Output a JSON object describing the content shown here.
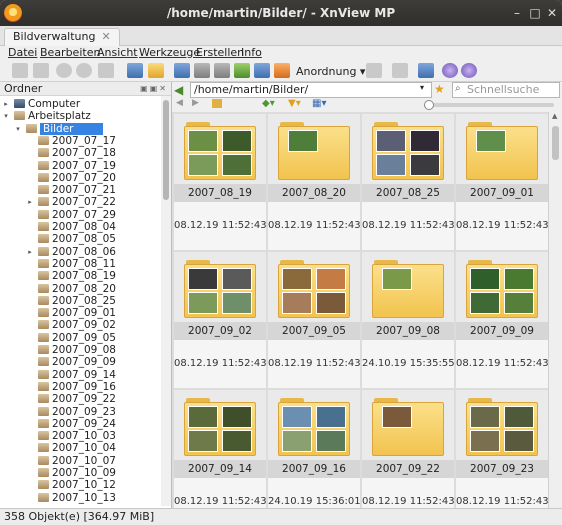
{
  "window": {
    "title": "/home/martin/Bilder/ - XnView MP"
  },
  "tab": {
    "label": "Bildverwaltung"
  },
  "menu": [
    "Datei",
    "Bearbeiten",
    "Ansicht",
    "Werkzeuge",
    "Erstellen",
    "Info"
  ],
  "toolbar": {
    "sort_label": "Anordnung"
  },
  "sidebar": {
    "header": "Ordner",
    "tree": [
      {
        "label": "Computer",
        "level": 0,
        "arrow": "▸",
        "icon": "computer-icon"
      },
      {
        "label": "Arbeitsplatz",
        "level": 0,
        "arrow": "▾",
        "icon": "home-folder-icon"
      },
      {
        "label": "Bilder",
        "level": 1,
        "arrow": "▾",
        "icon": "folder-icon",
        "selected": true
      },
      {
        "label": "2007_07_17",
        "level": 2,
        "arrow": ""
      },
      {
        "label": "2007_07_18",
        "level": 2,
        "arrow": ""
      },
      {
        "label": "2007_07_19",
        "level": 2,
        "arrow": ""
      },
      {
        "label": "2007_07_20",
        "level": 2,
        "arrow": ""
      },
      {
        "label": "2007_07_21",
        "level": 2,
        "arrow": ""
      },
      {
        "label": "2007_07_22",
        "level": 2,
        "arrow": "▸"
      },
      {
        "label": "2007_07_29",
        "level": 2,
        "arrow": ""
      },
      {
        "label": "2007_08_04",
        "level": 2,
        "arrow": ""
      },
      {
        "label": "2007_08_05",
        "level": 2,
        "arrow": ""
      },
      {
        "label": "2007_08_06",
        "level": 2,
        "arrow": "▸"
      },
      {
        "label": "2007_08_11",
        "level": 2,
        "arrow": ""
      },
      {
        "label": "2007_08_19",
        "level": 2,
        "arrow": ""
      },
      {
        "label": "2007_08_20",
        "level": 2,
        "arrow": ""
      },
      {
        "label": "2007_08_25",
        "level": 2,
        "arrow": ""
      },
      {
        "label": "2007_09_01",
        "level": 2,
        "arrow": ""
      },
      {
        "label": "2007_09_02",
        "level": 2,
        "arrow": ""
      },
      {
        "label": "2007_09_05",
        "level": 2,
        "arrow": ""
      },
      {
        "label": "2007_09_08",
        "level": 2,
        "arrow": ""
      },
      {
        "label": "2007_09_09",
        "level": 2,
        "arrow": ""
      },
      {
        "label": "2007_09_14",
        "level": 2,
        "arrow": ""
      },
      {
        "label": "2007_09_16",
        "level": 2,
        "arrow": ""
      },
      {
        "label": "2007_09_22",
        "level": 2,
        "arrow": ""
      },
      {
        "label": "2007_09_23",
        "level": 2,
        "arrow": ""
      },
      {
        "label": "2007_09_24",
        "level": 2,
        "arrow": ""
      },
      {
        "label": "2007_10_03",
        "level": 2,
        "arrow": ""
      },
      {
        "label": "2007_10_04",
        "level": 2,
        "arrow": ""
      },
      {
        "label": "2007_10_07",
        "level": 2,
        "arrow": ""
      },
      {
        "label": "2007_10_09",
        "level": 2,
        "arrow": ""
      },
      {
        "label": "2007_10_12",
        "level": 2,
        "arrow": ""
      },
      {
        "label": "2007_10_13",
        "level": 2,
        "arrow": ""
      }
    ]
  },
  "address": {
    "path": "/home/martin/Bilder/",
    "search_placeholder": "Schnellsuche"
  },
  "files": [
    {
      "name": "2007_08_19",
      "date": "08.12.19 11:52:43 ...",
      "photos": [
        "#6b8f45",
        "#3d5a2a",
        "#7a9b5a",
        "#4f6f38"
      ]
    },
    {
      "name": "2007_08_20",
      "date": "08.12.19 11:52:43 ...",
      "photos": [
        "#4f7d3a"
      ]
    },
    {
      "name": "2007_08_25",
      "date": "08.12.19 11:52:43 ...",
      "photos": [
        "#5a5f74",
        "#2f2a36",
        "#6a7f9a",
        "#3a3a3f"
      ]
    },
    {
      "name": "2007_09_01",
      "date": "08.12.19 11:52:43 ...",
      "photos": [
        "#5f8f4a"
      ]
    },
    {
      "name": "2007_09_02",
      "date": "08.12.19 11:52:43 ...",
      "photos": [
        "#3a3a3a",
        "#5a5a5a",
        "#7c9a5a",
        "#6f8f6a"
      ]
    },
    {
      "name": "2007_09_05",
      "date": "08.12.19 11:52:43 ...",
      "photos": [
        "#8a6a3a",
        "#c47b44",
        "#a67c5a",
        "#7a5a3a"
      ]
    },
    {
      "name": "2007_09_08",
      "date": "24.10.19 15:35:55 ...",
      "photos": [
        "#7a9a4a"
      ]
    },
    {
      "name": "2007_09_09",
      "date": "08.12.19 11:52:43 ...",
      "photos": [
        "#2f5f2a",
        "#4a7a2f",
        "#3f6a35",
        "#557f3a"
      ]
    },
    {
      "name": "2007_09_14",
      "date": "08.12.19 11:52:43 ...",
      "photos": [
        "#5a6a3a",
        "#3f4f2a",
        "#6f7a4a",
        "#4a5a30"
      ]
    },
    {
      "name": "2007_09_16",
      "date": "24.10.19 15:36:01 ...",
      "photos": [
        "#6a8fb0",
        "#4a7090",
        "#8aa070",
        "#5a7a5a"
      ]
    },
    {
      "name": "2007_09_22",
      "date": "08.12.19 11:52:43 ...",
      "photos": [
        "#7a5a3a"
      ]
    },
    {
      "name": "2007_09_23",
      "date": "08.12.19 11:52:43 ...",
      "photos": [
        "#6a6a4a",
        "#4f5a3a",
        "#7a7050",
        "#5a5a3f"
      ]
    }
  ],
  "status": {
    "text": "358 Objekt(e) [364.97 MiB]"
  }
}
